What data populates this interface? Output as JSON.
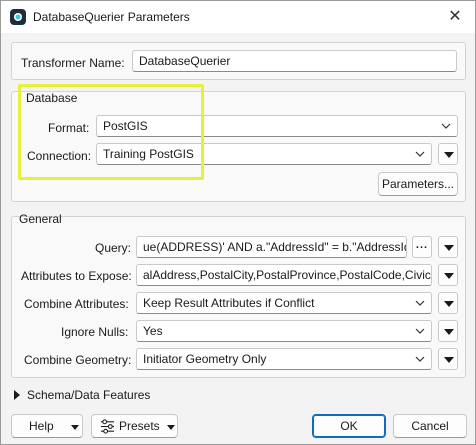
{
  "window": {
    "title": "DatabaseQuerier Parameters",
    "close_glyph": "✕"
  },
  "transformer": {
    "label": "Transformer Name:",
    "value": "DatabaseQuerier"
  },
  "database": {
    "group_label": "Database",
    "format_label": "Format:",
    "format_value": "PostGIS",
    "connection_label": "Connection:",
    "connection_value": "Training PostGIS",
    "parameters_button": "Parameters..."
  },
  "general": {
    "group_label": "General",
    "query_label": "Query:",
    "query_value": "ue(ADDRESS)'  AND a.\"AddressId\" = b.\"AddressId\";",
    "attributes_label": "Attributes to Expose:",
    "attributes_value": "alAddress,PostalCity,PostalProvince,PostalCode,CivicNo",
    "combine_attributes_label": "Combine Attributes:",
    "combine_attributes_value": "Keep Result Attributes if Conflict",
    "ignore_nulls_label": "Ignore Nulls:",
    "ignore_nulls_value": "Yes",
    "combine_geometry_label": "Combine Geometry:",
    "combine_geometry_value": "Initiator Geometry Only",
    "ellipsis": "..."
  },
  "schema": {
    "label": "Schema/Data Features"
  },
  "footer": {
    "help_label": "Help",
    "presets_label": "Presets",
    "ok_label": "OK",
    "cancel_label": "Cancel"
  },
  "colors": {
    "highlight": "#e4f03a",
    "primary_border": "#0f6cbd",
    "icon_dark": "#1d2d3a",
    "icon_accent": "#3fc8e0"
  },
  "icons": {
    "app": "app-logo-icon",
    "dropdown": "chevron-down-icon",
    "menu": "triangle-down-icon",
    "presets": "sliders-icon",
    "expander": "triangle-right-icon"
  }
}
